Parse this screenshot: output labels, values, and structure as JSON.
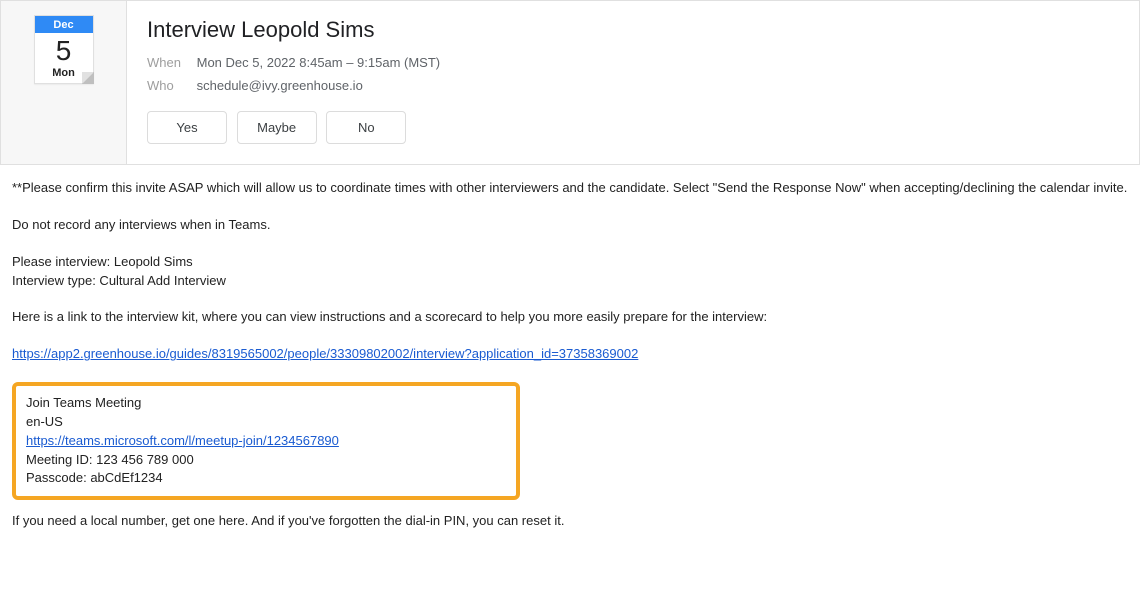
{
  "date_card": {
    "month": "Dec",
    "day": "5",
    "dow": "Mon"
  },
  "event": {
    "title": "Interview Leopold Sims",
    "when_label": "When",
    "when_value": "Mon Dec 5, 2022 8:45am – 9:15am (MST)",
    "who_label": "Who",
    "who_value": "schedule@ivy.greenhouse.io"
  },
  "rsvp": {
    "yes": "Yes",
    "maybe": "Maybe",
    "no": "No"
  },
  "body": {
    "confirm": "**Please confirm this invite ASAP which will allow us to coordinate times with other interviewers and the candidate. Select \"Send the Response Now\" when accepting/declining the calendar invite.",
    "no_record": "Do not record any interviews when in Teams.",
    "please_interview": "Please interview: Leopold Sims",
    "interview_type": "Interview type: Cultural Add Interview",
    "kit_intro": "Here is a link to the interview kit, where you can view instructions and a scorecard to help you more easily prepare for the interview:",
    "kit_link": "https://app2.greenhouse.io/guides/8319565002/people/33309802002/interview?application_id=37358369002",
    "footer": "If you need a local number, get one here. And if you've forgotten the dial-in PIN, you can reset it."
  },
  "teams": {
    "join": "Join Teams Meeting",
    "locale": "en-US",
    "link": "https://teams.microsoft.com/l/meetup-join/1234567890",
    "meeting_id": "Meeting ID: 123 456 789 000",
    "passcode": "Passcode: abCdEf1234"
  }
}
